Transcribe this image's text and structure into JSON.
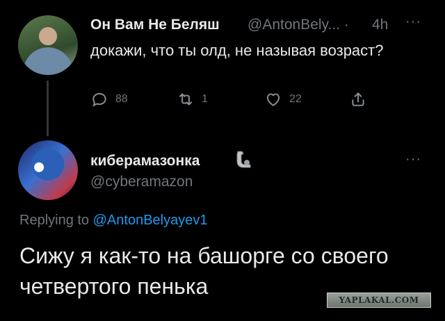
{
  "tweet1": {
    "display_name": "Он Вам Не Беляш",
    "handle": "@AntonBely...",
    "separator": "·",
    "time": "4h",
    "more": "···",
    "text": "докажи, что ты олд, не называя возраст?",
    "actions": {
      "replies": "88",
      "retweets": "1",
      "likes": "22"
    }
  },
  "tweet2": {
    "display_name": "кибер​амазонка",
    "name_emoji": "flexed-biceps-mechanical-icon",
    "handle": "@cyberamazon",
    "more": "···",
    "replying_prefix": "Replying to",
    "replying_handle": "@AntonBelyayev1",
    "text": "Сижу я как-то на башорге со своего четвертого пенька"
  },
  "watermark": "YAPLAKAL.COM",
  "colors": {
    "background": "#000000",
    "text": "#e7e9ea",
    "muted": "#71767b",
    "link": "#1d9bf0"
  }
}
